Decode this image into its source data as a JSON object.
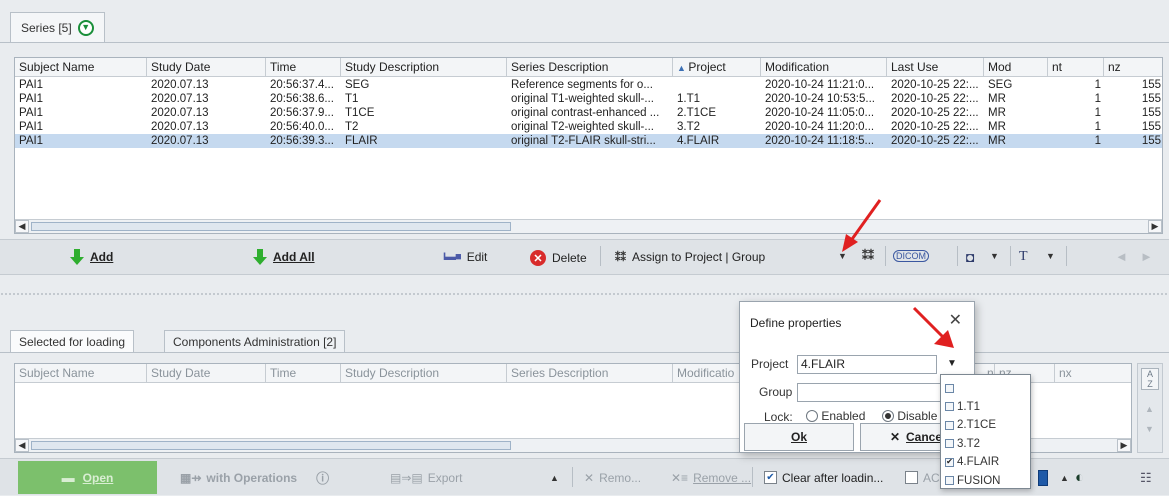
{
  "top_tab": {
    "label": "Series [5]"
  },
  "series_table": {
    "columns": [
      "Subject Name",
      "Study Date",
      "Time",
      "Study Description",
      "Series Description",
      "Project",
      "Modification",
      "Last Use",
      "Mod",
      "nt",
      "nz"
    ],
    "sorted_indicator": "▲",
    "rows": [
      [
        "PAI1",
        "2020.07.13",
        "20:56:37.4...",
        "SEG",
        "Reference segments for o...",
        "",
        "2020-10-24 11:21:0...",
        "2020-10-25 22:...",
        "SEG",
        "1",
        "155"
      ],
      [
        "PAI1",
        "2020.07.13",
        "20:56:38.6...",
        "T1",
        "original T1-weighted skull-...",
        "1.T1",
        "2020-10-24 10:53:5...",
        "2020-10-25 22:...",
        "MR",
        "1",
        "155"
      ],
      [
        "PAI1",
        "2020.07.13",
        "20:56:37.9...",
        "T1CE",
        "original contrast-enhanced ...",
        "2.T1CE",
        "2020-10-24 11:05:0...",
        "2020-10-25 22:...",
        "MR",
        "1",
        "155"
      ],
      [
        "PAI1",
        "2020.07.13",
        "20:56:40.0...",
        "T2",
        "original T2-weighted skull-...",
        "3.T2",
        "2020-10-24 11:20:0...",
        "2020-10-25 22:...",
        "MR",
        "1",
        "155"
      ],
      [
        "PAI1",
        "2020.07.13",
        "20:56:39.3...",
        "FLAIR",
        "original T2-FLAIR skull-stri...",
        "4.FLAIR",
        "2020-10-24 11:18:5...",
        "2020-10-25 22:...",
        "MR",
        "1",
        "155"
      ]
    ],
    "selected_row": 4
  },
  "toolbar": {
    "add": "Add",
    "add_all": "Add All",
    "edit": "Edit",
    "delete": "Delete",
    "assign": "Assign to Project | Group"
  },
  "lower_tabs": {
    "selected_for_loading": "Selected for loading",
    "components_admin": "Components Administration [2]"
  },
  "loading_table": {
    "columns": [
      "Subject Name",
      "Study Date",
      "Time",
      "Study Description",
      "Series Description",
      "Modificatio",
      "nt",
      "nz",
      "nx"
    ]
  },
  "bottom_bar": {
    "open": "Open",
    "with_operations": "with Operations",
    "export": "Export",
    "remove_short": "Remo...",
    "remove": "Remove ...",
    "clear_after_loading": "Clear after loadin...",
    "ac": "AC"
  },
  "dialog": {
    "title": "Define properties",
    "project_label": "Project",
    "project_value": "4.FLAIR",
    "group_label": "Group",
    "group_value": "",
    "lock_label": "Lock:",
    "enabled": "Enabled",
    "disabled": "Disable",
    "ok": "Ok",
    "cancel": "Cance"
  },
  "project_dropdown": {
    "options": [
      {
        "label": "",
        "checked": false
      },
      {
        "label": "1.T1",
        "checked": false
      },
      {
        "label": "2.T1CE",
        "checked": false
      },
      {
        "label": "3.T2",
        "checked": false
      },
      {
        "label": "4.FLAIR",
        "checked": true
      },
      {
        "label": "FUSION",
        "checked": false
      }
    ]
  },
  "colors": {
    "selected_row": "#c5d9ef",
    "open_button": "#7cc06c",
    "annotation_arrow": "#e02020"
  }
}
